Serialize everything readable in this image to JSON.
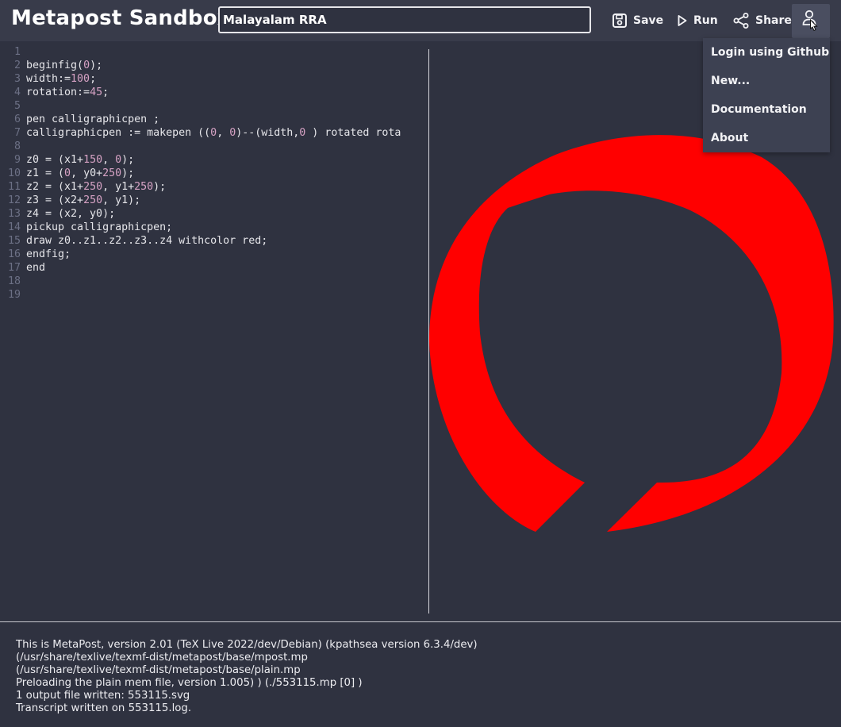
{
  "header": {
    "app_title": "Metapost Sandbox",
    "document_title": "Malayalam RRA",
    "save_label": "Save",
    "run_label": "Run",
    "share_label": "Share"
  },
  "user_menu": {
    "items": [
      {
        "label": "Login using Github"
      },
      {
        "label": "New..."
      },
      {
        "label": "Documentation"
      },
      {
        "label": "About"
      }
    ]
  },
  "editor": {
    "line_numbers": [
      "1",
      "2",
      "3",
      "4",
      "5",
      "6",
      "7",
      "8",
      "9",
      "10",
      "11",
      "12",
      "13",
      "14",
      "15",
      "16",
      "17",
      "18",
      "19"
    ],
    "lines": [
      "",
      "beginfig(0);",
      "width:=100;",
      "rotation:=45;",
      "",
      "pen calligraphicpen ;",
      "calligraphicpen := makepen ((0, 0)--(width,0 ) rotated rota",
      "",
      "z0 = (x1+150, 0);",
      "z1 = (0, y0+250);",
      "z2 = (x1+250, y1+250);",
      "z3 = (x2+250, y1);",
      "z4 = (x2, y0);",
      "pickup calligraphicpen;",
      "draw z0..z1..z2..z3..z4 withcolor red;",
      "endfig;",
      "end",
      "",
      ""
    ]
  },
  "preview": {
    "stroke_color": "#ff0000"
  },
  "log": {
    "lines": [
      "This is MetaPost, version 2.01 (TeX Live 2022/dev/Debian) (kpathsea version 6.3.4/dev)",
      "(/usr/share/texlive/texmf-dist/metapost/base/mpost.mp",
      "(/usr/share/texlive/texmf-dist/metapost/base/plain.mp",
      "Preloading the plain mem file, version 1.005) ) (./553115.mp [0] )",
      "1 output file written: 553115.svg",
      "Transcript written on 553115.log."
    ]
  },
  "colors": {
    "background": "#2f3240",
    "topbar": "#383b4a",
    "menu": "#3d4152",
    "number_literal": "#d6a2c4"
  }
}
